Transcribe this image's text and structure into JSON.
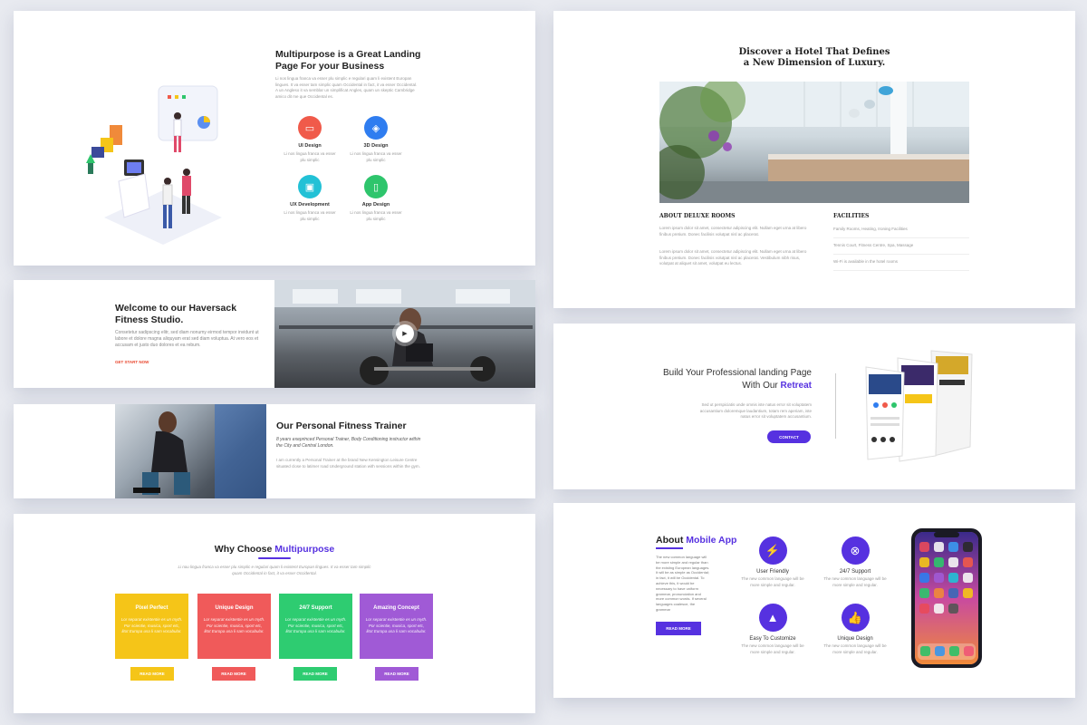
{
  "multipurpose": {
    "title": "Multipurpose is a Great Landing Page For your Business",
    "intro": "Li nos lingua franca va esser plu simplic e regulari quam li existent Europan lingues. It va esser tam simplic quam Occidental in fact, it va esser Occidental. A un Angleso it va semblar un simplificat Angles, quam un skeptic Cambridge amico dit me que Occidental es.",
    "services": [
      {
        "name": "UI Design",
        "text": "Li nos lingua franca va esser plu simplic",
        "color": "#f05a4a",
        "icon": "monitor-icon"
      },
      {
        "name": "3D Design",
        "text": "Li nos lingua franca va esser plu simplic",
        "color": "#2f7df0",
        "icon": "cube-icon"
      },
      {
        "name": "UX Development",
        "text": "Li nos lingua franca va esser plu simplic",
        "color": "#22c1d6",
        "icon": "code-window-icon"
      },
      {
        "name": "App Design",
        "text": "Li nos lingua franca va esser plu simplic",
        "color": "#2ec56c",
        "icon": "mobile-icon"
      }
    ]
  },
  "welcome": {
    "title": "Welcome to our Haversack Fitness Studio.",
    "desc": "Consetetur sadipscing elitr, sed diam nonumy eirmod tempor invidunt ut labore et dolore magna aliquyam erat sed diam voluptua. At vero eos et accusam et justo duo dolores et ea rebum.",
    "cta": "GET START NOW",
    "play": "▶"
  },
  "trainer": {
    "title": "Our Personal Fitness Trainer",
    "sub": "8 years exeprinced Personal Trainer, Body Conditioning instructor within the City and Central London.",
    "desc": "I am currently a Personal Trainer at the brand New Kensington Leisure Centre situated close to latimer road Underground station with sessions within the gym."
  },
  "why": {
    "title_pre": "Why Choose ",
    "title_accent": "Multipurpose",
    "intro": "Li nou lingua franca va esser plu simplic e regulari quam li existent Europan lingues. It va esser tam simplic quam Occidental in fact, it va esser Occidental.",
    "features": [
      {
        "name": "Pixel Perfect",
        "text": "Lor separat existentie es un myth. Por scientie, musica, sport etc, litot Europa usa li sam vocabular.",
        "color": "#f5c518",
        "button": "READ MORE"
      },
      {
        "name": "Unique Design",
        "text": "Lor separat existentie es un myth. Por scientie, musica, sport etc, litot Europa usa li sam vocabular.",
        "color": "#f05a5a",
        "button": "READ MORE"
      },
      {
        "name": "24/7 Support",
        "text": "Lor separat existentie es un myth. Por scientie, musica, sport etc, litot Europa usa li sam vocabular.",
        "color": "#2ecc71",
        "button": "READ MORE"
      },
      {
        "name": "Amazing Concept",
        "text": "Lor separat existentie es un myth. Por scientie, musica, sport etc, litot Europa usa li sam vocabular.",
        "color": "#a05ad6",
        "button": "READ MORE"
      }
    ]
  },
  "hotel": {
    "title": "Discover a Hotel That Defines a New Dimension of Luxury.",
    "about_title": "ABOUT DELUXE ROOMS",
    "p1": "Lorem ipsum dolor sit amet, consectetur adipiscing elit. Nullam eget urna at libero finibus pretium. Donec facilisis volutpat nisl ac placerat.",
    "p2": "Lorem ipsum dolor sit amet, consectetur adipiscing elit. Nullam eget urna at libero finibus pretium. Donec facilisis volutpat nisl ac placerat. Vestibulum nibh risus, volutpat at aliquet sit amet, volutpat eu lectus.",
    "facilities_title": "FACILITIES",
    "facilities": [
      "Family Rooms, Heating, Ironing Facilities",
      "Tennis Court, Fitness Centre, Spa, Massage",
      "Wi-Fi is available in the hotel rooms"
    ]
  },
  "retreat": {
    "title_pre": "Build Your Professional landing Page With Our ",
    "title_accent": "Retreat",
    "desc": "Sed ut perspiciatis unde omnis iste natus error sit voluptatem accusantium doloremque laudantium, totam rem aperiam, iste natus error sit voluptatem accusantium.",
    "button": "CONTACT"
  },
  "mobile": {
    "title_pre": "About ",
    "title_accent": "Mobile App",
    "desc": "The new common language will be more simple and regular than the existing European languages. It will be as simple as Occidental; in fact, it will be Occidental. To achieve this, it would be necessary to have uniform grammar, pronunciation and more common words. If several languages coalesce, the grammar",
    "button": "READ MORE",
    "features": [
      {
        "name": "User Friendly",
        "text": "The new common language will be more simple and regular.",
        "icon": "bolt-icon"
      },
      {
        "name": "24/7 Support",
        "text": "The new common language will be more simple and regular.",
        "icon": "support-icon"
      },
      {
        "name": "Easy To Customize",
        "text": "The new common language will be more simple and regular.",
        "icon": "road-icon"
      },
      {
        "name": "Unique Design",
        "text": "The new common language will be more simple and regular.",
        "icon": "thumbs-up-icon"
      }
    ]
  }
}
